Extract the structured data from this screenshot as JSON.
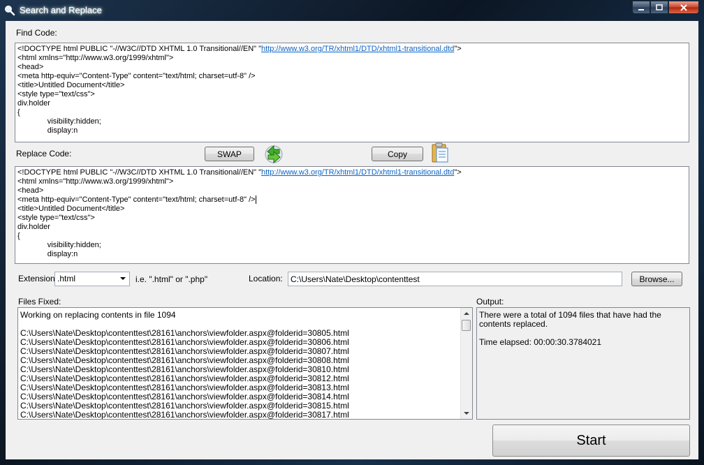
{
  "window": {
    "title": "Search and Replace"
  },
  "find": {
    "label": "Find Code:",
    "lines": [
      {
        "pre": "<!DOCTYPE html PUBLIC \"-//W3C//DTD XHTML 1.0 Transitional//EN\" \"",
        "link": "http://www.w3.org/TR/xhtml1/DTD/xhtml1-transitional.dtd",
        "post": "\">"
      },
      {
        "pre": "<html xmlns=\"http://www.w3.org/1999/xhtml\">"
      },
      {
        "pre": "<head>"
      },
      {
        "pre": "<meta http-equiv=\"Content-Type\" content=\"text/html; charset=utf-8\" />"
      },
      {
        "pre": "<title>Untitled Document</title>"
      },
      {
        "pre": "<style type=\"text/css\">"
      },
      {
        "pre": "div.holder"
      },
      {
        "pre": "{"
      },
      {
        "pre": "              visibility:hidden;"
      },
      {
        "pre": "              display:n"
      }
    ]
  },
  "replace": {
    "label": "Replace Code:",
    "swap_label": "SWAP",
    "copy_label": "Copy",
    "lines": [
      {
        "pre": "<!DOCTYPE html PUBLIC \"-//W3C//DTD XHTML 1.0 Transitional//EN\" \"",
        "link": "http://www.w3.org/TR/xhtml1/DTD/xhtml1-transitional.dtd",
        "post": "\">"
      },
      {
        "pre": "<html xmlns=\"http://www.w3.org/1999/xhtml\">"
      },
      {
        "pre": "<head>"
      },
      {
        "pre": "<meta http-equiv=\"Content-Type\" content=\"text/html; charset=utf-8\" />",
        "caret": true
      },
      {
        "pre": "<title>Untitled Document</title>"
      },
      {
        "pre": "<style type=\"text/css\">"
      },
      {
        "pre": "div.holder"
      },
      {
        "pre": "{"
      },
      {
        "pre": "              visibility:hidden;"
      },
      {
        "pre": "              display:n"
      }
    ]
  },
  "options": {
    "extension_label": "Extension:",
    "extension_value": ".html",
    "extension_hint": "i.e.  \".html\" or \".php\"",
    "location_label": "Location:",
    "location_value": "C:\\Users\\Nate\\Desktop\\contenttest",
    "browse_label": "Browse..."
  },
  "files": {
    "label": "Files Fixed:",
    "lines": [
      "Working on replacing contents in file 1094",
      "",
      "C:\\Users\\Nate\\Desktop\\contenttest\\28161\\anchors\\viewfolder.aspx@folderid=30805.html",
      "C:\\Users\\Nate\\Desktop\\contenttest\\28161\\anchors\\viewfolder.aspx@folderid=30806.html",
      "C:\\Users\\Nate\\Desktop\\contenttest\\28161\\anchors\\viewfolder.aspx@folderid=30807.html",
      "C:\\Users\\Nate\\Desktop\\contenttest\\28161\\anchors\\viewfolder.aspx@folderid=30808.html",
      "C:\\Users\\Nate\\Desktop\\contenttest\\28161\\anchors\\viewfolder.aspx@folderid=30810.html",
      "C:\\Users\\Nate\\Desktop\\contenttest\\28161\\anchors\\viewfolder.aspx@folderid=30812.html",
      "C:\\Users\\Nate\\Desktop\\contenttest\\28161\\anchors\\viewfolder.aspx@folderid=30813.html",
      "C:\\Users\\Nate\\Desktop\\contenttest\\28161\\anchors\\viewfolder.aspx@folderid=30814.html",
      "C:\\Users\\Nate\\Desktop\\contenttest\\28161\\anchors\\viewfolder.aspx@folderid=30815.html",
      "C:\\Users\\Nate\\Desktop\\contenttest\\28161\\anchors\\viewfolder.aspx@folderid=30817.html"
    ]
  },
  "output": {
    "label": "Output:",
    "line1": "There were a total of 1094 files that have had the contents replaced.",
    "line2": "Time elapsed: 00:00:30.3784021"
  },
  "start_label": "Start",
  "icons": {
    "window": "search-icon",
    "swap": "swap-arrows-icon",
    "copy": "clipboard-icon"
  }
}
